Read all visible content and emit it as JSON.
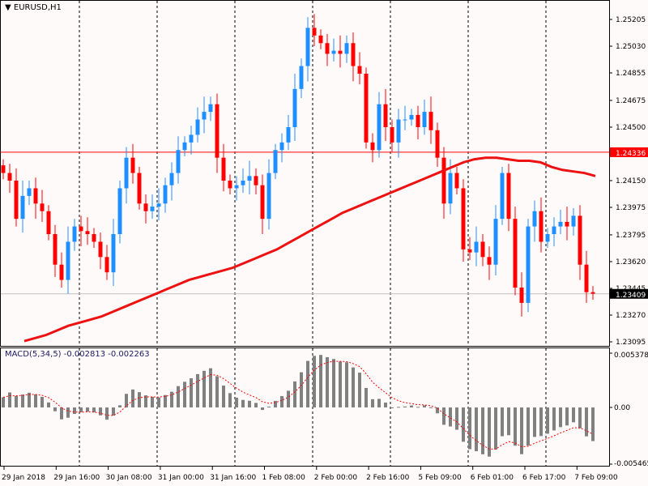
{
  "symbol_title": "EURUSD,H1",
  "macd_label": "MACD(5,34,5) -0.002813 -0.002263",
  "colors": {
    "bull": "#1e90ff",
    "bear": "#ff0000",
    "ma": "#ee1111",
    "hist": "#808080",
    "signal": "#ff0000",
    "bid_line": "#ff0000",
    "ask_line": "#c0c0c0"
  },
  "price_axis": {
    "ticks": [
      "1.25205",
      "1.25030",
      "1.24855",
      "1.24675",
      "1.24500",
      "1.24150",
      "1.23975",
      "1.23795",
      "1.23620",
      "1.23445",
      "1.23270",
      "1.23095"
    ],
    "max": 1.25205,
    "min": 1.23095
  },
  "price_markers": {
    "red_line": "1.24336",
    "current": "1.23409"
  },
  "macd_axis": {
    "top": "0.005378",
    "zero": "0.00",
    "bottom": "-0.005465",
    "max": 0.005378,
    "min": -0.005465
  },
  "time_axis": [
    "29 Jan 2018",
    "29 Jan 16:00",
    "30 Jan 08:00",
    "31 Jan 00:00",
    "31 Jan 16:00",
    "1 Feb 08:00",
    "2 Feb 00:00",
    "2 Feb 16:00",
    "5 Feb 09:00",
    "6 Feb 01:00",
    "6 Feb 17:00",
    "7 Feb 09:00"
  ],
  "closes": [
    1.242,
    1.2415,
    1.239,
    1.2405,
    1.241,
    1.24,
    1.2395,
    1.238,
    1.236,
    1.235,
    1.2375,
    1.2385,
    1.2382,
    1.238,
    1.2375,
    1.2365,
    1.2355,
    1.238,
    1.241,
    1.243,
    1.242,
    1.24,
    1.2395,
    1.2398,
    1.24,
    1.2412,
    1.242,
    1.2435,
    1.244,
    1.2445,
    1.2455,
    1.246,
    1.2465,
    1.243,
    1.2415,
    1.241,
    1.2412,
    1.2415,
    1.2418,
    1.2412,
    1.239,
    1.242,
    1.2435,
    1.244,
    1.245,
    1.2475,
    1.249,
    1.2515,
    1.251,
    1.2505,
    1.2498,
    1.25,
    1.2498,
    1.2505,
    1.249,
    1.2485,
    1.244,
    1.2435,
    1.2465,
    1.245,
    1.244,
    1.2455,
    1.2455,
    1.2458,
    1.245,
    1.246,
    1.2448,
    1.243,
    1.24,
    1.242,
    1.241,
    1.237,
    1.2368,
    1.2375,
    1.2365,
    1.236,
    1.239,
    1.242,
    1.239,
    1.2345,
    1.2335,
    1.2385,
    1.2395,
    1.2375,
    1.238,
    1.2385,
    1.2388,
    1.2385,
    1.2392,
    1.236,
    1.2342,
    1.2341
  ],
  "moving_average": [
    1.231,
    1.2312,
    1.2314,
    1.2317,
    1.232,
    1.2322,
    1.2324,
    1.2326,
    1.2329,
    1.2332,
    1.2335,
    1.2338,
    1.2341,
    1.2344,
    1.2347,
    1.235,
    1.2352,
    1.2354,
    1.2356,
    1.2358,
    1.2361,
    1.2364,
    1.2367,
    1.237,
    1.2374,
    1.2378,
    1.2382,
    1.2386,
    1.239,
    1.2394,
    1.2397,
    1.24,
    1.2403,
    1.2406,
    1.2409,
    1.2412,
    1.2415,
    1.2418,
    1.2421,
    1.2424,
    1.2427,
    1.2429,
    1.243,
    1.243,
    1.2429,
    1.2428,
    1.2428,
    1.2427,
    1.2424,
    1.2422,
    1.2421,
    1.242,
    1.2418
  ]
}
